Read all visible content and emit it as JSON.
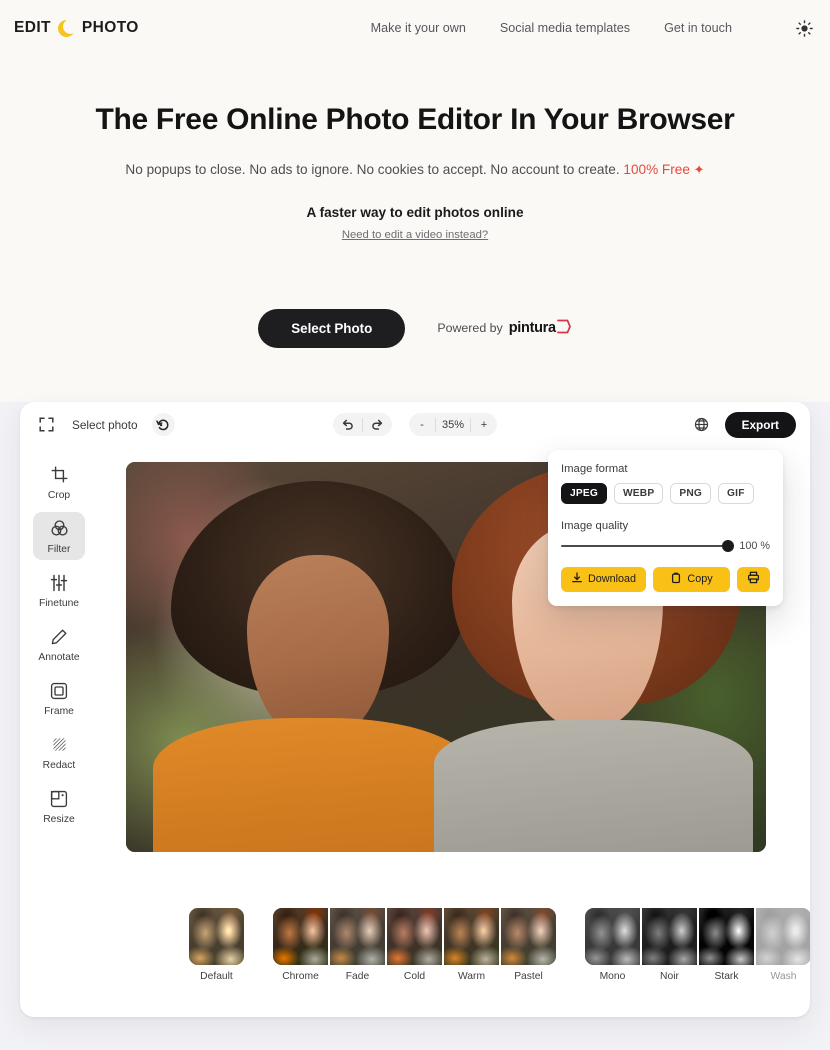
{
  "header": {
    "logo": {
      "word1": "EDIT",
      "word2": "PHOTO",
      "mark": "moon-icon"
    },
    "nav": [
      {
        "label": "Make it your own"
      },
      {
        "label": "Social media templates"
      },
      {
        "label": "Get in touch"
      }
    ],
    "theme_toggle_icon": "sun-icon"
  },
  "hero": {
    "title": "The Free Online Photo Editor In Your Browser",
    "subtitle_plain": "No popups to close. No ads to ignore. No cookies to accept. No account to create.",
    "subtitle_highlight": "100% Free",
    "sparkle": "✦",
    "tagline": "A faster way to edit photos online",
    "video_link": "Need to edit a video instead?",
    "cta_label": "Select Photo",
    "powered_by": "Powered by",
    "powered_brand": "pintura"
  },
  "editor": {
    "toolbar": {
      "fullscreen_icon": "expand-icon",
      "select_photo_label": "Select photo",
      "revert_icon": "history-revert-icon",
      "undo_icon": "undo-icon",
      "redo_icon": "redo-icon",
      "zoom_out_label": "-",
      "zoom_level": "35%",
      "zoom_in_label": "+",
      "globe_icon": "globe-icon",
      "export_label": "Export"
    },
    "export_panel": {
      "format_label": "Image format",
      "formats": [
        {
          "label": "JPEG",
          "active": true
        },
        {
          "label": "WEBP",
          "active": false
        },
        {
          "label": "PNG",
          "active": false
        },
        {
          "label": "GIF",
          "active": false
        }
      ],
      "quality_label": "Image quality",
      "quality_value": "100 %",
      "quality_percent": 100,
      "download_label": "Download",
      "copy_label": "Copy",
      "print_icon": "printer-icon",
      "accent_color": "#f9c116"
    },
    "tools": [
      {
        "label": "Crop",
        "icon": "crop-icon",
        "active": false
      },
      {
        "label": "Filter",
        "icon": "filter-circles-icon",
        "active": true
      },
      {
        "label": "Finetune",
        "icon": "sliders-icon",
        "active": false
      },
      {
        "label": "Annotate",
        "icon": "pencil-icon",
        "active": false
      },
      {
        "label": "Frame",
        "icon": "frame-icon",
        "active": false
      },
      {
        "label": "Redact",
        "icon": "redact-icon",
        "active": false
      },
      {
        "label": "Resize",
        "icon": "resize-icon",
        "active": false
      }
    ],
    "filters_group_a": [
      {
        "label": "Default",
        "selected": true
      },
      {
        "label": "Chrome",
        "selected": false
      },
      {
        "label": "Fade",
        "selected": false
      },
      {
        "label": "Cold",
        "selected": false
      },
      {
        "label": "Warm",
        "selected": false
      },
      {
        "label": "Pastel",
        "selected": false
      }
    ],
    "filters_group_b": [
      {
        "label": "Mono",
        "selected": false
      },
      {
        "label": "Noir",
        "selected": false
      },
      {
        "label": "Stark",
        "selected": false
      },
      {
        "label": "Wash",
        "selected": false
      }
    ]
  },
  "colors": {
    "page_bg": "#f2f1f5",
    "hero_bg": "#faf9f6",
    "brand_yellow": "#f5c518",
    "accent_red": "#e8493c",
    "dark": "#1e1e20"
  }
}
